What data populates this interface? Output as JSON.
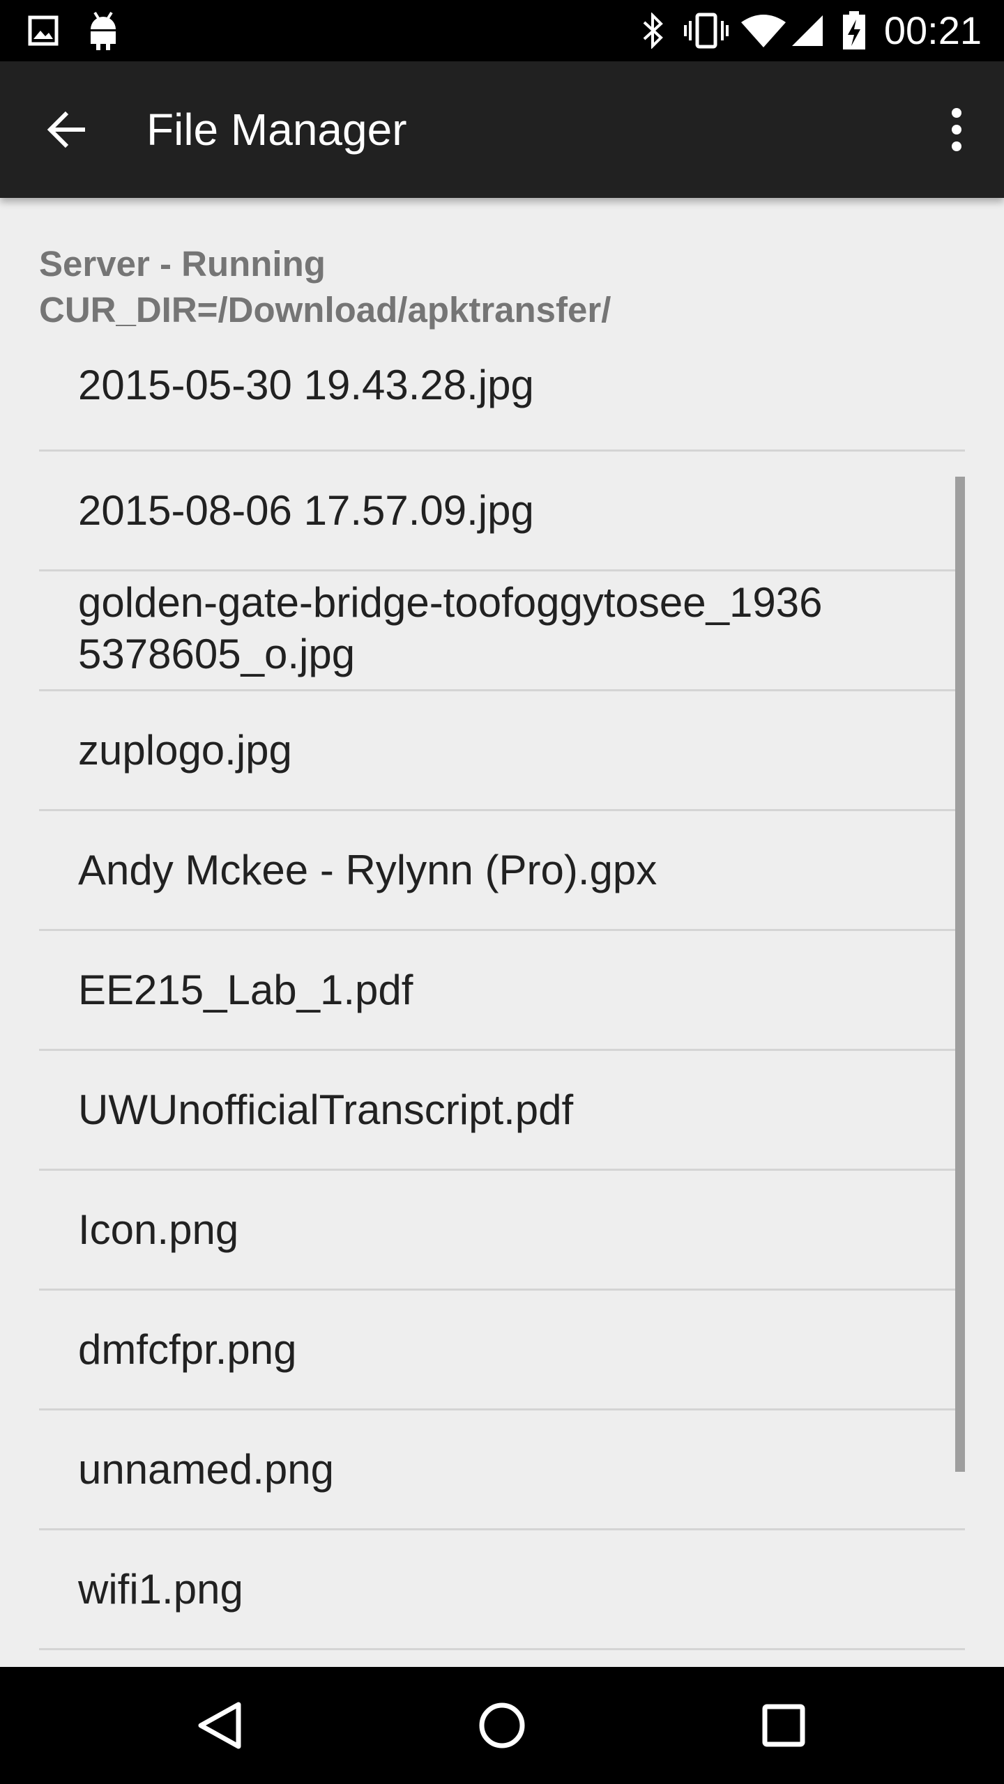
{
  "status_bar": {
    "time": "00:21",
    "left_icons": [
      "image-icon",
      "android-icon"
    ],
    "right_icons": [
      "bluetooth-icon",
      "vibrate-icon",
      "wifi-icon",
      "cell-signal-icon",
      "battery-charging-icon"
    ]
  },
  "app_bar": {
    "title": "File Manager",
    "back_icon": "arrow-back-icon",
    "menu_icon": "more-vert-icon"
  },
  "server": {
    "status": "Server - Running",
    "cur_dir": "CUR_DIR=/Download/apktransfer/"
  },
  "files": [
    "2015-05-30 19.43.28.jpg",
    "2015-08-06 17.57.09.jpg",
    "golden-gate-bridge-toofoggytosee_19365378605_o.jpg",
    "zuplogo.jpg",
    "Andy Mckee - Rylynn (Pro).gpx",
    "EE215_Lab_1.pdf",
    "UWUnofficialTranscript.pdf",
    "Icon.png",
    "dmfcfpr.png",
    "unnamed.png",
    "wifi1.png"
  ],
  "nav_bar": {
    "icons": [
      "nav-back-icon",
      "nav-home-icon",
      "nav-recents-icon"
    ]
  },
  "colors": {
    "status_bar": "#000000",
    "app_bar": "#212121",
    "background": "#eeeeee",
    "divider": "#d4d4d4",
    "server_text": "#757575",
    "file_text": "#212121"
  }
}
